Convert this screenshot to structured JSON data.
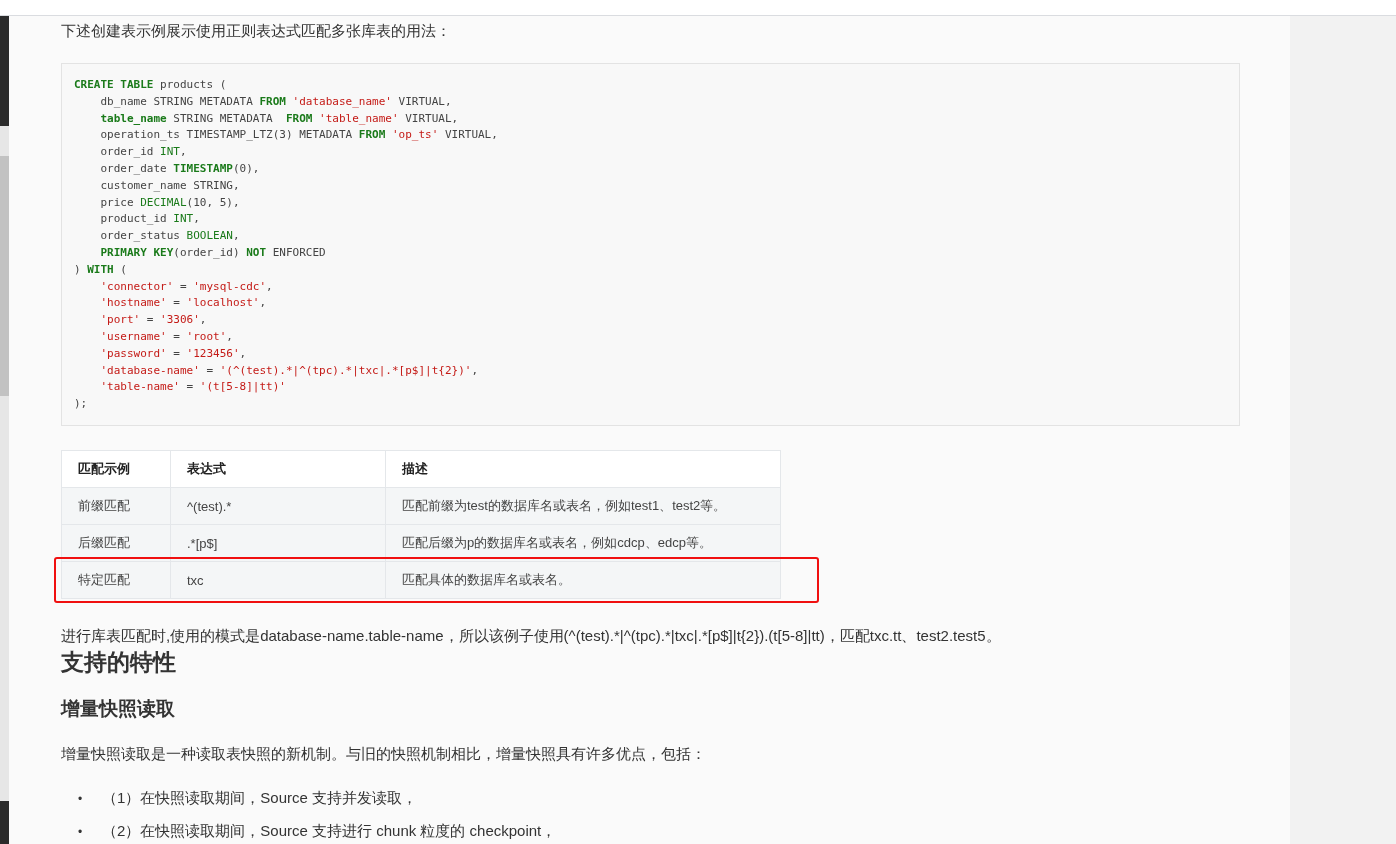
{
  "intro": "下述创建表示例展示使用正则表达式匹配多张库表的用法：",
  "code": [
    [
      {
        "kind": "kw",
        "t": "CREATE TABLE"
      },
      {
        "kind": "plain",
        "t": " products ("
      }
    ],
    [
      {
        "kind": "plain",
        "t": "    db_name STRING METADATA "
      },
      {
        "kind": "kw",
        "t": "FROM"
      },
      {
        "kind": "str",
        "t": " 'database_name'"
      },
      {
        "kind": "plain",
        "t": " VIRTUAL,"
      }
    ],
    [
      {
        "kind": "kw",
        "t": "    table_name"
      },
      {
        "kind": "plain",
        "t": " STRING METADATA  "
      },
      {
        "kind": "kw",
        "t": "FROM"
      },
      {
        "kind": "str",
        "t": " 'table_name'"
      },
      {
        "kind": "plain",
        "t": " VIRTUAL,"
      }
    ],
    [
      {
        "kind": "plain",
        "t": "    operation_ts TIMESTAMP_LTZ(3) METADATA "
      },
      {
        "kind": "kw",
        "t": "FROM"
      },
      {
        "kind": "str",
        "t": " 'op_ts'"
      },
      {
        "kind": "plain",
        "t": " VIRTUAL,"
      }
    ],
    [
      {
        "kind": "plain",
        "t": "    order_id "
      },
      {
        "kind": "type",
        "t": "INT"
      },
      {
        "kind": "plain",
        "t": ","
      }
    ],
    [
      {
        "kind": "plain",
        "t": "    order_date "
      },
      {
        "kind": "kw",
        "t": "TIMESTAMP"
      },
      {
        "kind": "plain",
        "t": "(0),"
      }
    ],
    [
      {
        "kind": "plain",
        "t": "    customer_name STRING,"
      }
    ],
    [
      {
        "kind": "plain",
        "t": "    price "
      },
      {
        "kind": "type",
        "t": "DECIMAL"
      },
      {
        "kind": "plain",
        "t": "(10, 5),"
      }
    ],
    [
      {
        "kind": "plain",
        "t": "    product_id "
      },
      {
        "kind": "type",
        "t": "INT"
      },
      {
        "kind": "plain",
        "t": ","
      }
    ],
    [
      {
        "kind": "plain",
        "t": "    order_status "
      },
      {
        "kind": "type",
        "t": "BOOLEAN"
      },
      {
        "kind": "plain",
        "t": ","
      }
    ],
    [
      {
        "kind": "kw",
        "t": "    PRIMARY KEY"
      },
      {
        "kind": "plain",
        "t": "(order_id) "
      },
      {
        "kind": "kw",
        "t": "NOT"
      },
      {
        "kind": "plain",
        "t": " ENFORCED"
      }
    ],
    [
      {
        "kind": "plain",
        "t": ") "
      },
      {
        "kind": "kw",
        "t": "WITH"
      },
      {
        "kind": "plain",
        "t": " ("
      }
    ],
    [
      {
        "kind": "str",
        "t": "    'connector'"
      },
      {
        "kind": "plain",
        "t": " = "
      },
      {
        "kind": "str",
        "t": "'mysql-cdc'"
      },
      {
        "kind": "plain",
        "t": ","
      }
    ],
    [
      {
        "kind": "str",
        "t": "    'hostname'"
      },
      {
        "kind": "plain",
        "t": " = "
      },
      {
        "kind": "str",
        "t": "'localhost'"
      },
      {
        "kind": "plain",
        "t": ","
      }
    ],
    [
      {
        "kind": "str",
        "t": "    'port'"
      },
      {
        "kind": "plain",
        "t": " = "
      },
      {
        "kind": "str",
        "t": "'3306'"
      },
      {
        "kind": "plain",
        "t": ","
      }
    ],
    [
      {
        "kind": "str",
        "t": "    'username'"
      },
      {
        "kind": "plain",
        "t": " = "
      },
      {
        "kind": "str",
        "t": "'root'"
      },
      {
        "kind": "plain",
        "t": ","
      }
    ],
    [
      {
        "kind": "str",
        "t": "    'password'"
      },
      {
        "kind": "plain",
        "t": " = "
      },
      {
        "kind": "str",
        "t": "'123456'"
      },
      {
        "kind": "plain",
        "t": ","
      }
    ],
    [
      {
        "kind": "str",
        "t": "    'database-name'"
      },
      {
        "kind": "plain",
        "t": " = "
      },
      {
        "kind": "str",
        "t": "'(^(test).*|^(tpc).*|txc|.*[p$]|t{2})'"
      },
      {
        "kind": "plain",
        "t": ","
      }
    ],
    [
      {
        "kind": "str",
        "t": "    'table-name'"
      },
      {
        "kind": "plain",
        "t": " = "
      },
      {
        "kind": "str",
        "t": "'(t[5-8]|tt)'"
      }
    ],
    [
      {
        "kind": "plain",
        "t": ");"
      }
    ]
  ],
  "table": {
    "columns": [
      "匹配示例",
      "表达式",
      "描述"
    ],
    "rows": [
      {
        "cells": [
          "前缀匹配",
          "^(test).*",
          "匹配前缀为test的数据库名或表名，例如test1、test2等。"
        ],
        "highlighted": false
      },
      {
        "cells": [
          "后缀匹配",
          ".*[p$]",
          "匹配后缀为p的数据库名或表名，例如cdcp、edcp等。"
        ],
        "highlighted": false
      },
      {
        "cells": [
          "特定匹配",
          "txc",
          "匹配具体的数据库名或表名。"
        ],
        "highlighted": true
      }
    ]
  },
  "note": "进行库表匹配时,使用的模式是database-name.table-name，所以该例子使用(^(test).*|^(tpc).*|txc|.*[p$]|t{2}).(t[5-8]|tt)，匹配txc.tt、test2.test5。",
  "heading": "支持的特性",
  "subheading": "增量快照读取",
  "paragraph": "增量快照读取是一种读取表快照的新机制。与旧的快照机制相比，增量快照具有许多优点，包括：",
  "bullets": [
    {
      "marker": "•",
      "text": "（1）在快照读取期间，Source 支持并发读取，"
    },
    {
      "marker": "•",
      "text": "（2）在快照读取期间，Source 支持进行 chunk 粒度的 checkpoint，"
    }
  ]
}
